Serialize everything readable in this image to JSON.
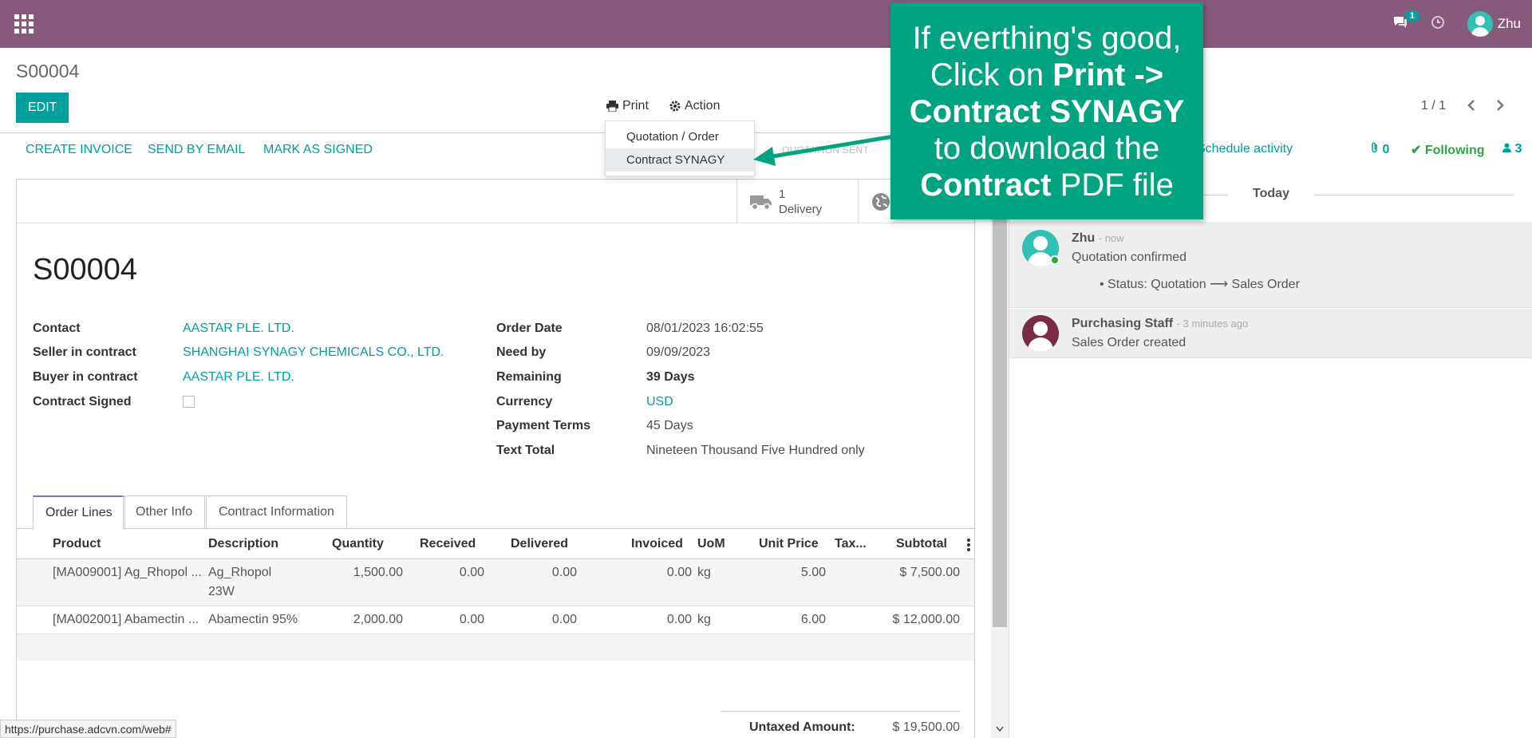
{
  "navbar": {
    "message_count": "1",
    "user_name": "Zhu"
  },
  "breadcrumb": "S00004",
  "toolbar": {
    "edit_label": "EDIT",
    "print_label": "Print",
    "action_label": "Action",
    "pager": "1 / 1"
  },
  "print_menu": {
    "items": [
      "Quotation / Order",
      "Contract SYNAGY"
    ],
    "active_item": "Contract SYNAGY"
  },
  "statusbar": {
    "buttons": [
      "CREATE INVOICE",
      "SEND BY EMAIL",
      "MARK AS SIGNED"
    ],
    "state_partial": "QUOTATION SENT"
  },
  "smart_buttons": {
    "delivery_count": "1",
    "delivery_label": "Delivery"
  },
  "form": {
    "title": "S00004",
    "left": [
      {
        "label": "Contact",
        "value": "AASTAR PLE. LTD."
      },
      {
        "label": "Seller in contract",
        "value": "SHANGHAI SYNAGY CHEMICALS CO., LTD."
      },
      {
        "label": "Buyer in contract",
        "value": "AASTAR PLE. LTD."
      },
      {
        "label": "Contract Signed",
        "value": ""
      }
    ],
    "right": [
      {
        "label": "Order Date",
        "value": "08/01/2023 16:02:55"
      },
      {
        "label": "Need by",
        "value": "09/09/2023"
      },
      {
        "label": "Remaining",
        "value": "39 Days"
      },
      {
        "label": "Currency",
        "value": "USD"
      },
      {
        "label": "Payment Terms",
        "value": "45 Days"
      },
      {
        "label": "Text Total",
        "value": "Nineteen Thousand Five Hundred only"
      }
    ]
  },
  "tabs": [
    "Order Lines",
    "Other Info",
    "Contract Information"
  ],
  "order_lines": {
    "headers": [
      "Product",
      "Description",
      "Quantity",
      "Received",
      "Delivered",
      "Invoiced",
      "UoM",
      "Unit Price",
      "Tax...",
      "Subtotal"
    ],
    "rows": [
      {
        "product": "[MA009001] Ag_Rhopol ...",
        "description_1": "Ag_Rhopol",
        "description_2": "23W",
        "quantity": "1,500.00",
        "received": "0.00",
        "delivered": "0.00",
        "invoiced": "0.00",
        "uom": "kg",
        "unit_price": "5.00",
        "subtotal": "$ 7,500.00"
      },
      {
        "product": "[MA002001] Abamectin ...",
        "description_1": "Abamectin 95%",
        "description_2": "",
        "quantity": "2,000.00",
        "received": "0.00",
        "delivered": "0.00",
        "invoiced": "0.00",
        "uom": "kg",
        "unit_price": "6.00",
        "subtotal": "$ 12,000.00"
      }
    ],
    "untaxed_label": "Untaxed Amount:",
    "untaxed_value": "$ 19,500.00"
  },
  "chatter": {
    "schedule_activity": "Schedule activity",
    "attachments": "0",
    "following": "Following",
    "followers": "3",
    "today": "Today",
    "messages": [
      {
        "author": "Zhu",
        "when": "- now",
        "text": "Quotation confirmed",
        "tracking": "Status: Quotation",
        "tracking_new": "Sales Order"
      },
      {
        "author": "Purchasing Staff",
        "when": "- 3 minutes ago",
        "text": "Sales Order created"
      }
    ]
  },
  "callout": {
    "line1": "If everthing's good,",
    "line2a": "Click on ",
    "line2b": "Print ->",
    "line3": "Contract SYNAGY",
    "line4": "to download the",
    "line5a": "Contract",
    "line5b": " PDF file"
  },
  "status_url": "https://purchase.adcvn.com/web#",
  "colors": {
    "navbar": "#875a7b",
    "primary": "#00a09d",
    "callout": "#00a481",
    "following": "#28a745"
  }
}
